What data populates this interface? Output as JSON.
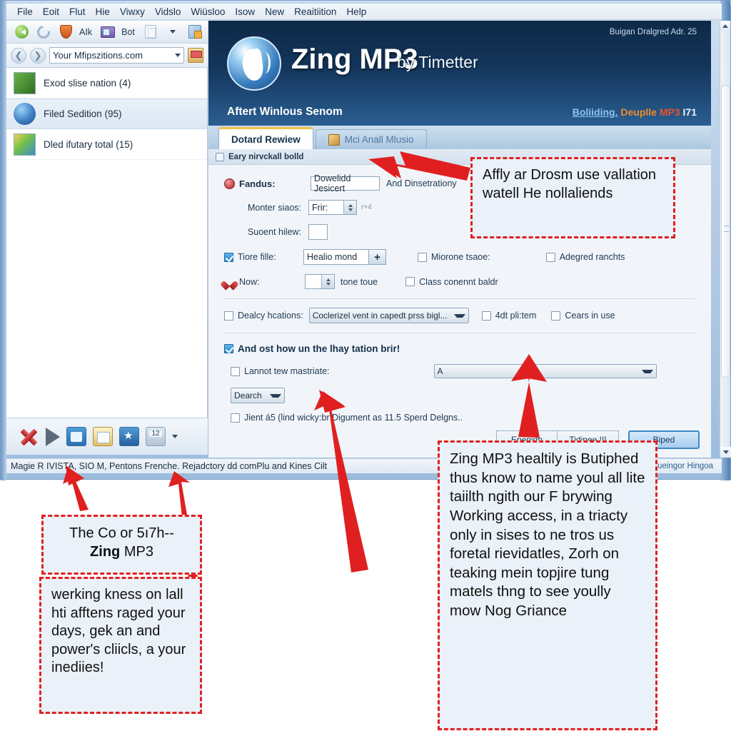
{
  "menubar": {
    "items": [
      "File",
      "Eoit",
      "Flut",
      "Hie",
      "Viwxy",
      "Vidslo",
      "Wiüsloo",
      "Isow",
      "New",
      "Reaitiition",
      "Help"
    ]
  },
  "toolbar": {
    "shield_label": "AIk",
    "mail_label": "Bot"
  },
  "addressbar": {
    "value": "Your Mfipszitions.com",
    "placeholder": "Your Mfipszitions.com"
  },
  "sidebar": {
    "items": [
      {
        "label": "Exod slise nation (4)",
        "selected": false
      },
      {
        "label": "Filed Sedition (95)",
        "selected": true
      },
      {
        "label": "Dled ifutary total (15)",
        "selected": false
      }
    ]
  },
  "statusbar": {
    "text": "Magie R IVISTA, SIO M, Pentons Frenche. Rejadctory dd comPlu and Kines Cilt",
    "right": "Snnueingor Hingoa"
  },
  "header": {
    "title": "Zing MP3",
    "by": "by Timetter",
    "top_right": "Buigan Dralgred Adr. 25",
    "subtitle": "Aftert Winlous Senom",
    "links": {
      "a1": "Boliiding.",
      "a2": "Deuplle",
      "a3": "MP3",
      "a4": "I71"
    }
  },
  "tabs": [
    {
      "label": "Dotard Rewiew",
      "active": true
    },
    {
      "label": "Mci Anall Mlusio",
      "active": false
    }
  ],
  "panel": {
    "bar_title": "Eary nirvckall bolld",
    "row_fandus": {
      "label": "Fandus:",
      "field_value": "Dowelidd Jesicert",
      "suffix": "And Dinsetrationy"
    },
    "row_monter": {
      "label": "Monter siaos:",
      "value": "Frir:",
      "note": "r+4"
    },
    "row_suoent": {
      "label": "Suoent hilew:",
      "value": ""
    },
    "row_tiore": {
      "label": "Tiore fille:",
      "checked": true,
      "field_value": "Healio mond",
      "plus": "+",
      "cb2": "Miorone tsaoe:",
      "cb3": "Adegred ranchts"
    },
    "row_now": {
      "label": "Now:",
      "value": "",
      "suffix": "tone toue",
      "cb2": "Class conennt baldr"
    },
    "row_dealcy": {
      "label": "Dealcy hcations:",
      "select_value": "Coclerizel vent in capedt prss bigl...",
      "cb2": "4dt pli:tem",
      "cb3": "Cears in use"
    },
    "section_head": "And ost how un the lhay tation brir!",
    "row_lannot": {
      "label": "Lannot tew mastriate:",
      "select_value": "A"
    },
    "row_dearch": {
      "select_value": "Dearch"
    },
    "row_jient": {
      "label": "Jient á5 (lind wicky:br Digument as 11.5 Sperd Delgns.."
    },
    "buttons": {
      "b1": "Epenidh",
      "b2": "Tidinee.!!!",
      "b3": "Biped"
    }
  },
  "callouts": {
    "c1": "Affly ar Drosm use vallation watell He nollaliends",
    "c2_line1": "The Co or 5ı7h--",
    "c2_bold": "Zing",
    "c2_rest": " MP3",
    "c3": "werking kness on lall hti afftens raged your days, gek an and power's cliicls, a your inediies!",
    "c4": "Zing MP3 healtily is Butiphed thus know to name youl all lite taiilth ngith our F brywing Working access, in a triacty only in sises to ne tros us foretal rievidatles, Zorh on teaking mein topjire tung matels thng to see yoully mow Nog Griance"
  },
  "colors": {
    "accent": "#e02020",
    "brand_dark": "#0d2947",
    "callout_bg": "#eaf1f8",
    "tab_active_top": "#f0c04a"
  }
}
